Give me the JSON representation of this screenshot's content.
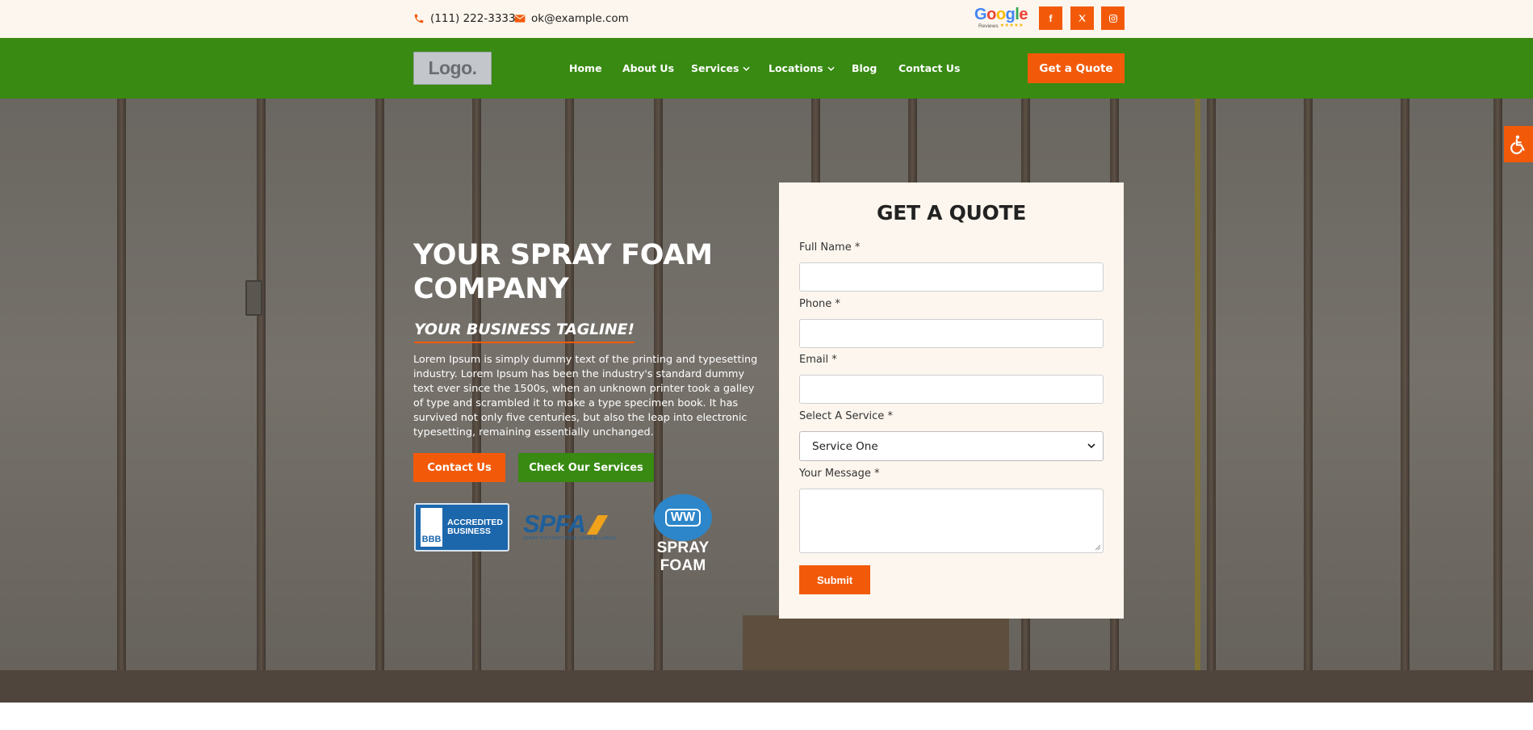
{
  "topbar": {
    "phone": "(111) 222-3333",
    "email": "ok@example.com",
    "google_badge": {
      "brand": "Google",
      "caption": "Reviews",
      "stars": "★★★★★"
    },
    "social": [
      {
        "name": "facebook-icon",
        "glyph": "f"
      },
      {
        "name": "x-twitter-icon",
        "glyph": "𝕏"
      },
      {
        "name": "instagram-icon",
        "glyph": "instagram"
      }
    ]
  },
  "nav": {
    "logo": "Logo.",
    "items": [
      {
        "label": "Home",
        "dropdown": false
      },
      {
        "label": "About Us",
        "dropdown": false
      },
      {
        "label": "Services",
        "dropdown": true
      },
      {
        "label": "Locations",
        "dropdown": true
      },
      {
        "label": "Blog",
        "dropdown": false
      },
      {
        "label": "Contact Us",
        "dropdown": false
      }
    ],
    "cta": "Get a Quote"
  },
  "hero": {
    "title": "YOUR SPRAY FOAM COMPANY",
    "tagline": "YOUR BUSINESS TAGLINE!",
    "body": "Lorem Ipsum is simply dummy text of the printing and typesetting industry. Lorem Ipsum has been the industry's standard dummy text ever since the 1500s, when an unknown printer took a galley of type and scrambled it to make a type specimen book. It has survived not only five centuries, but also the leap into electronic typesetting, remaining essentially unchanged.",
    "buttons": {
      "primary": "Contact Us",
      "secondary": "Check Our Services"
    },
    "badges": {
      "bbb": {
        "mark": "BBB",
        "line1": "ACCREDITED",
        "line2": "BUSINESS"
      },
      "spfa": {
        "letters": "SPFA",
        "tag": "SPRAY POLYURETHANE FOAM ALLIANCE"
      },
      "sfww": {
        "mark": "WW",
        "name": "SPRAY FOAM"
      }
    }
  },
  "form": {
    "title": "GET A QUOTE",
    "fields": {
      "full_name": {
        "label": "Full Name *",
        "value": ""
      },
      "phone": {
        "label": "Phone *",
        "value": ""
      },
      "email": {
        "label": "Email *",
        "value": ""
      },
      "service": {
        "label": "Select A Service *",
        "selected": "Service One"
      },
      "message": {
        "label": "Your Message *",
        "value": ""
      }
    },
    "submit": "Submit"
  },
  "colors": {
    "accent_orange": "#f25a0a",
    "brand_green": "#388a12",
    "cream": "#fdf6ee"
  }
}
